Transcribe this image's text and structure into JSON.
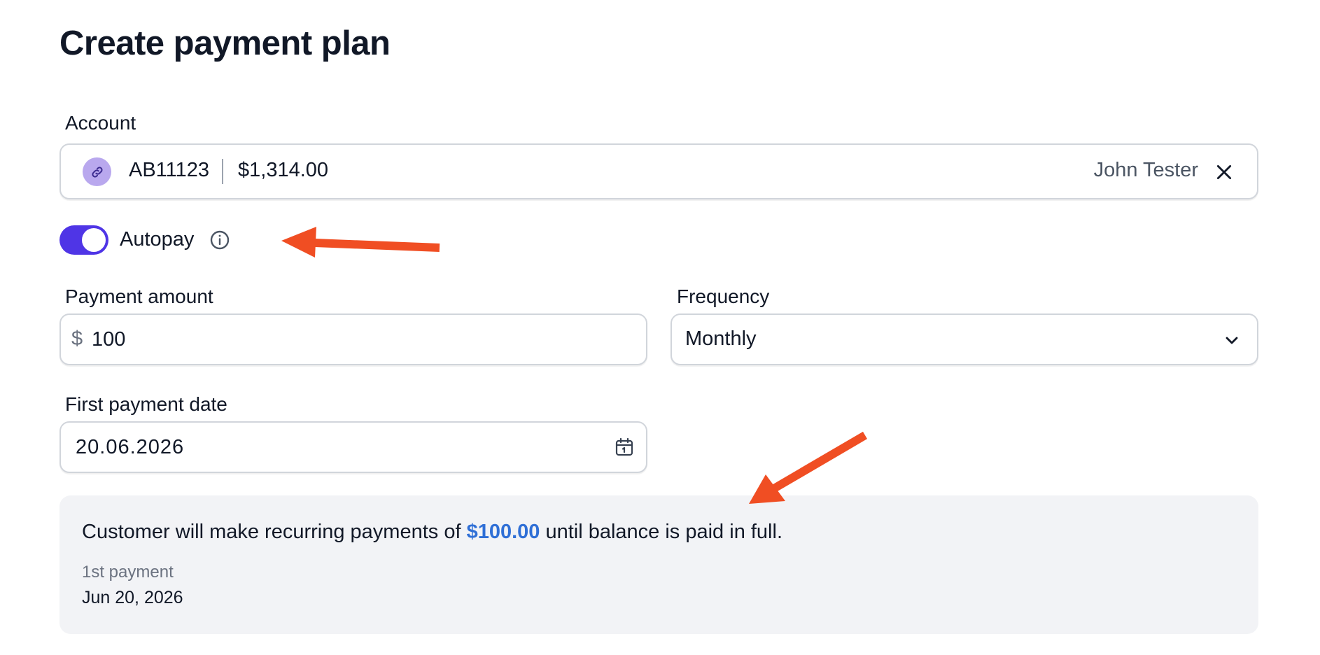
{
  "page": {
    "title": "Create payment plan"
  },
  "account": {
    "label": "Account",
    "icon": "link-icon",
    "id": "AB11123",
    "balance": "$1,314.00",
    "holder": "John Tester",
    "clear_icon": "close-icon"
  },
  "autopay": {
    "label": "Autopay",
    "enabled": true,
    "info_icon": "info-icon"
  },
  "payment_amount": {
    "label": "Payment amount",
    "currency": "$",
    "value": "100"
  },
  "frequency": {
    "label": "Frequency",
    "selected": "Monthly",
    "icon": "chevron-down-icon"
  },
  "first_payment_date": {
    "label": "First payment date",
    "value": "20.06.2026",
    "icon": "calendar-icon"
  },
  "summary": {
    "text_before": "Customer will make recurring payments of ",
    "amount": "$100.00",
    "text_after": " until balance is paid in full.",
    "first_payment_label": "1st payment",
    "first_payment_date": "Jun 20, 2026"
  },
  "colors": {
    "accent": "#4f35e6",
    "link_amount": "#2f6fd6",
    "annotation_arrow": "#f04e23",
    "link_badge": "#b9a8ee"
  }
}
